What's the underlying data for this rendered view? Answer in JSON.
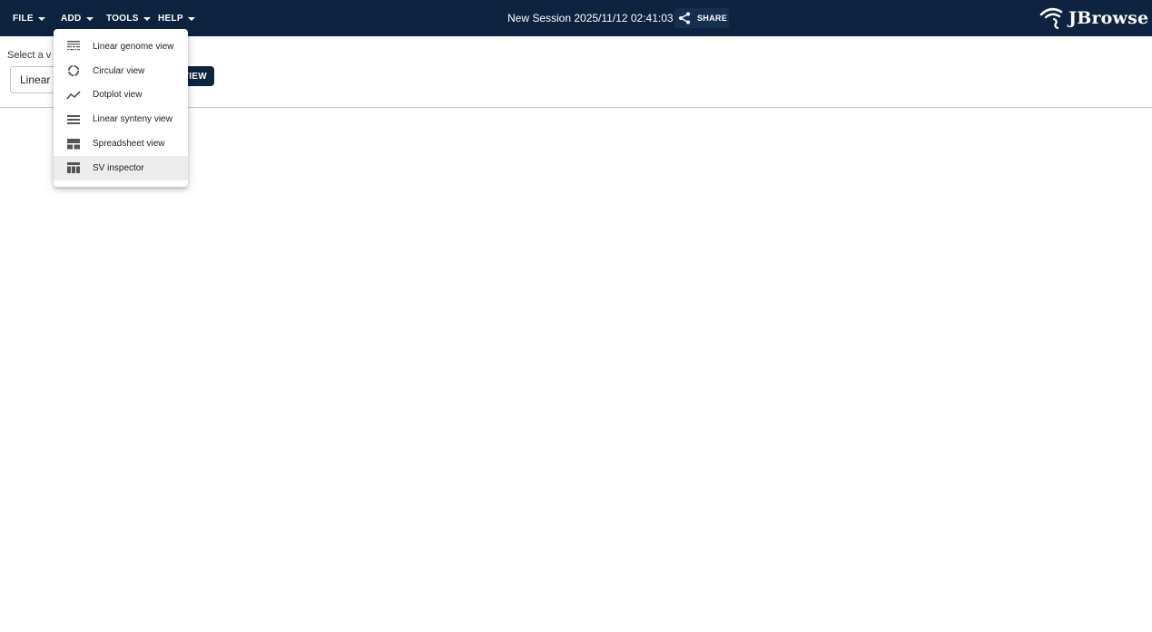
{
  "menubar": {
    "file": "FILE",
    "add": "ADD",
    "tools": "TOOLS",
    "help": "HELP"
  },
  "session": {
    "title": "New Session 2025/11/12 02:41:03",
    "share_label": "SHARE"
  },
  "logo": {
    "text": "JBrowse"
  },
  "main": {
    "select_label": "Select a v",
    "select_value": "Linear g",
    "launch_label": "VIEW"
  },
  "add_menu": {
    "items": [
      {
        "label": "Linear genome view",
        "icon": "linear-genome-icon"
      },
      {
        "label": "Circular view",
        "icon": "circular-icon"
      },
      {
        "label": "Dotplot view",
        "icon": "dotplot-icon"
      },
      {
        "label": "Linear synteny view",
        "icon": "synteny-icon"
      },
      {
        "label": "Spreadsheet view",
        "icon": "spreadsheet-icon"
      },
      {
        "label": "SV inspector",
        "icon": "sv-inspector-icon"
      }
    ]
  },
  "colors": {
    "appbar": "#0d233f",
    "hover": "#ececec"
  }
}
